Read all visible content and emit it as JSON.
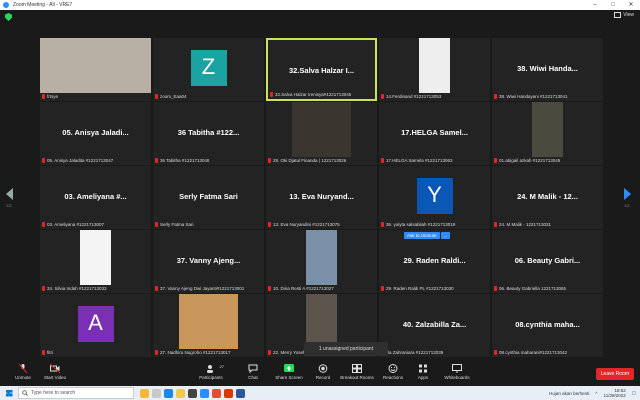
{
  "window": {
    "title": "Zoom Meeting - All - VRE7",
    "controls": [
      "–",
      "□",
      "✕"
    ]
  },
  "view": {
    "label": "View"
  },
  "pagination": {
    "left": "1/2",
    "right": "1/2"
  },
  "tiles": [
    {
      "name": "",
      "label": "frtsye",
      "kind": "photo",
      "color": "#b8b0a5"
    },
    {
      "name": "",
      "label": "zoom_Eaa04",
      "kind": "avatar",
      "letter": "Z",
      "color": "#1aa3a0"
    },
    {
      "name": "32.Salva Halzar I...",
      "label": "32.Salva Halzar Irenisya#1221713046",
      "kind": "text",
      "active": true
    },
    {
      "name": "",
      "label": "14.Ferdinand #1221713053",
      "kind": "photo",
      "color": "#eeeeee"
    },
    {
      "name": "38. Wiwi Handa...",
      "label": "38. Wiwi Handayani #1221713041",
      "kind": "text"
    },
    {
      "name": "05. Anisya Jaladi...",
      "label": "05. Anisya Jaladita #1221713047",
      "kind": "text"
    },
    {
      "name": "36 Tabitha #122...",
      "label": "36 Tabitha #1221713048",
      "kind": "text"
    },
    {
      "name": "",
      "label": "28. Oki Djatul Finanda | 1221713026",
      "kind": "photo",
      "color": "#3b3530"
    },
    {
      "name": "17.HELGA Samel...",
      "label": "17.HELGA Samela #1221713063",
      "kind": "text"
    },
    {
      "name": "",
      "label": "01.abigail azkah #1221713045",
      "kind": "photo",
      "color": "#4a4a3f"
    },
    {
      "name": "03. Ameliyana #...",
      "label": "03. Ameliyana #1221713007",
      "kind": "text"
    },
    {
      "name": "Serly Fatma Sari",
      "label": "Serly Fatma Sari",
      "kind": "text"
    },
    {
      "name": "13. Eva Nuryand...",
      "label": "13. Eva Nuryandini #1221713075",
      "kind": "text"
    },
    {
      "name": "",
      "label": "36. yulyta salsabilah #1221713019",
      "kind": "avatar",
      "letter": "Y",
      "color": "#0b57b5"
    },
    {
      "name": "24. M Malik - 12...",
      "label": "24. M Malik - 1221713031",
      "kind": "text"
    },
    {
      "name": "",
      "label": "34. Silvia Indah #1221713033",
      "kind": "photo",
      "color": "#f4f4f4"
    },
    {
      "name": "37. Vanny Ajeng...",
      "label": "37. Vanny Ajeng Dwi Jayanti#1221713001",
      "kind": "text"
    },
    {
      "name": "",
      "label": "10. Dina Resti A #1221713027",
      "kind": "photo",
      "color": "#7a8fa8"
    },
    {
      "name": "29. Raden Raldi...",
      "label": "29. Raden Raldi PL #1221713030",
      "kind": "text"
    },
    {
      "name": "06. Beauty Gabri...",
      "label": "06. Beauty Gabriella 1221713065",
      "kind": "text"
    },
    {
      "name": "",
      "label": "fitri",
      "kind": "avatar",
      "letter": "A",
      "color": "#7b2fb5"
    },
    {
      "name": "",
      "label": "27. Nadhira Nugroho #1221713017",
      "kind": "photo",
      "color": "#c9965b"
    },
    {
      "name": "",
      "label": "22. Merry Yosef",
      "kind": "photo",
      "color": "#5c544c"
    },
    {
      "name": "40. Zalzabilla Za...",
      "label": "illa Zahraniara #1221713039",
      "kind": "text"
    },
    {
      "name": "08.cynthia maha...",
      "label": "08.cynthia maharani#1221713042",
      "kind": "text"
    }
  ],
  "popup": {
    "ask": "Ask to Unmute",
    "more": "..."
  },
  "unassigned": "1 unassigned participant",
  "toolbar": {
    "unmute": "Unmute",
    "start_video": "Start Video",
    "participants": "Participants",
    "participants_count": "27",
    "chat": "Chat",
    "share_screen": "Share Screen",
    "record": "Record",
    "breakout": "Breakout Rooms",
    "reactions": "Reactions",
    "apps": "Apps",
    "whiteboards": "Whiteboards",
    "leave": "Leave Room"
  },
  "taskbar": {
    "search_placeholder": "Type here to search",
    "weather": "Hujan akan berhenti",
    "time": "18:52",
    "date": "11/28/2022"
  },
  "colors": {
    "accent": "#2d8cff",
    "active_border": "#c9e25a",
    "leave": "#e02828",
    "share": "#23d959"
  }
}
